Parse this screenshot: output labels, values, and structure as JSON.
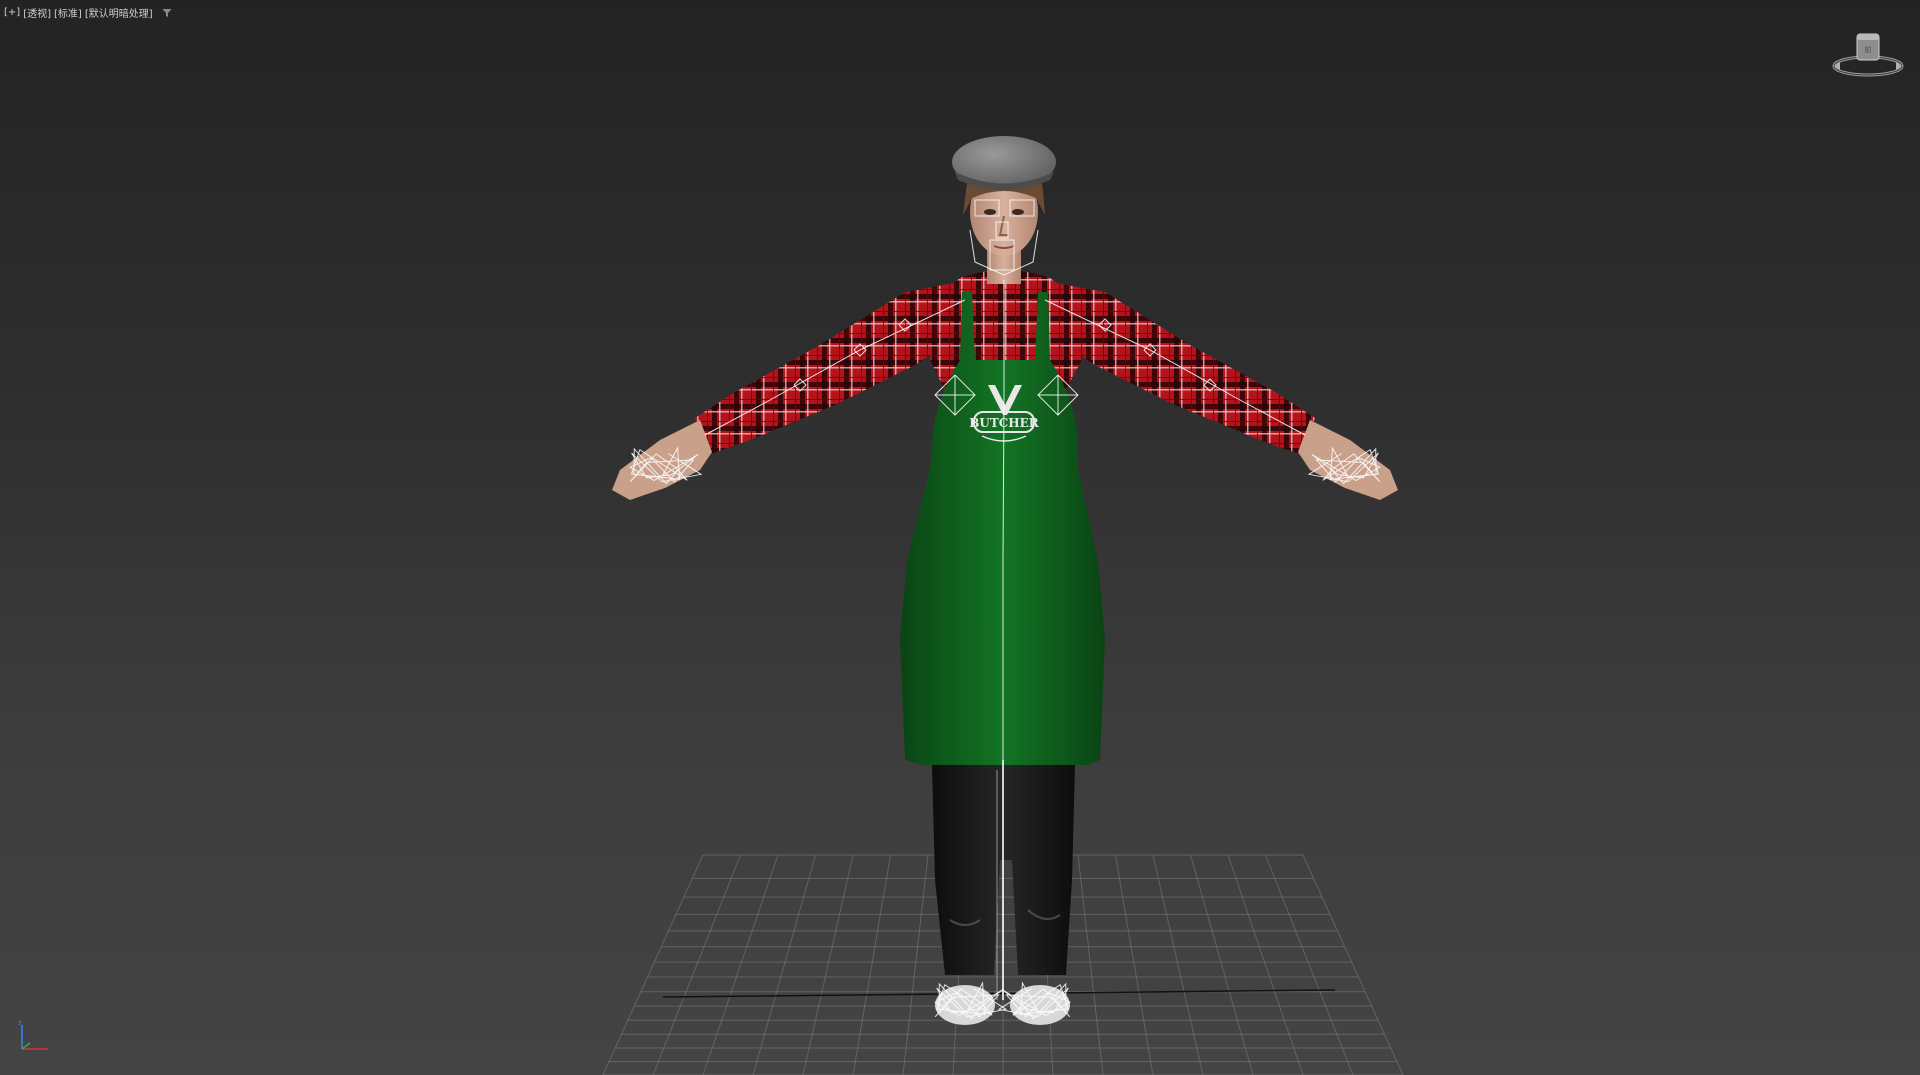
{
  "viewport": {
    "labels": [
      "[+]",
      "[透视]",
      "[标准]",
      "[默认明暗处理]"
    ]
  },
  "scene": {
    "apron_logo_text": "BUTCHER"
  },
  "colors": {
    "shirt_red": "#b3141c",
    "shirt_dark": "#2a0406",
    "apron_green": "#0e5a1a",
    "pants": "#141414",
    "skin": "#c9a08a",
    "cap": "#7a7a7a",
    "grid_line": "#8a8a8a",
    "wireframe": "#ffffff"
  },
  "icons": {
    "filter": "filter-funnel-icon",
    "viewcube": "viewcube-icon",
    "axis": "axis-tripod-icon"
  }
}
